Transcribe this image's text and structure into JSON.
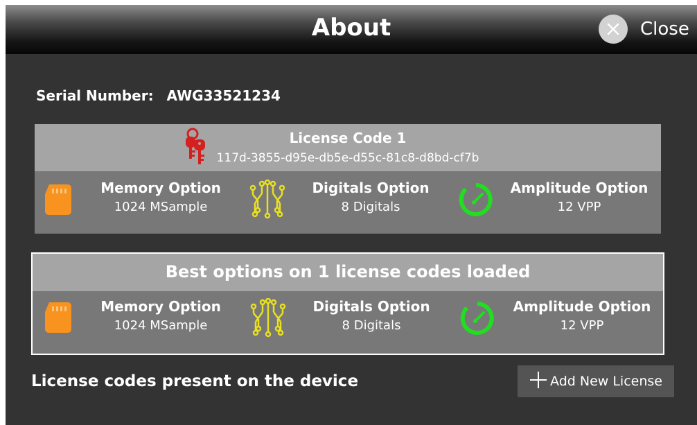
{
  "window": {
    "title": "About",
    "close_label": "Close"
  },
  "serial": {
    "label": "Serial Number:",
    "value": "AWG33521234"
  },
  "license": {
    "title": "License Code  1",
    "code": "117d-3855-d95e-db5e-d55c-81c8-d8bd-cf7b",
    "options": [
      {
        "title": "Memory Option",
        "value": "1024 MSample",
        "icon": "sd-card-icon"
      },
      {
        "title": "Digitals Option",
        "value": "8 Digitals",
        "icon": "circuit-icon"
      },
      {
        "title": "Amplitude Option",
        "value": "12 VPP",
        "icon": "gauge-icon"
      }
    ]
  },
  "best": {
    "title": "Best options on  1  license codes loaded",
    "options": [
      {
        "title": "Memory Option",
        "value": "1024 MSample",
        "icon": "sd-card-icon"
      },
      {
        "title": "Digitals Option",
        "value": "8 Digitals",
        "icon": "circuit-icon"
      },
      {
        "title": "Amplitude Option",
        "value": "12 VPP",
        "icon": "gauge-icon"
      }
    ]
  },
  "footer": {
    "present_label": "License codes present on the device",
    "add_button_label": "Add New License"
  },
  "colors": {
    "memory_icon": "#f7931e",
    "digitals_icon": "#e8e020",
    "amplitude_icon": "#22dd22",
    "key_icon": "#d42020"
  }
}
